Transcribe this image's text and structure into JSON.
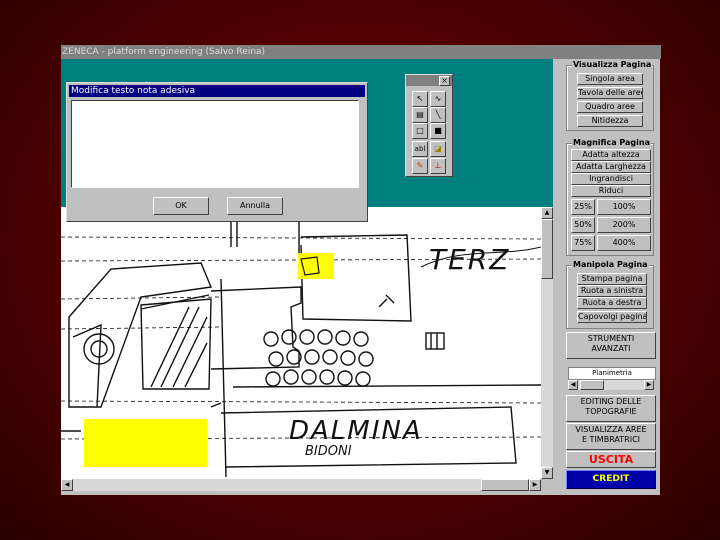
{
  "window": {
    "title": "ZENECA - platform engineering (Salvo Reina)"
  },
  "dialog": {
    "title": "Modifica testo nota adesiva",
    "text_value": "",
    "ok_label": "OK",
    "cancel_label": "Annulla"
  },
  "toolbox": {
    "close_glyph": "×",
    "tools": [
      {
        "name": "pointer",
        "glyph": "↖"
      },
      {
        "name": "freehand",
        "glyph": "∿"
      },
      {
        "name": "highlighter",
        "glyph": "▤"
      },
      {
        "name": "line",
        "glyph": "╲"
      },
      {
        "name": "hollow-rectangle",
        "glyph": "□"
      },
      {
        "name": "filled-rectangle",
        "glyph": "■"
      },
      {
        "name": "text",
        "glyph": "abl"
      },
      {
        "name": "sticky-note",
        "glyph": "◪"
      },
      {
        "name": "image-stamp",
        "glyph": "✎"
      },
      {
        "name": "rubber-stamp",
        "glyph": "⊥"
      }
    ]
  },
  "drawing": {
    "label_tert": "TERZ",
    "label_dalmina": "DALMINA",
    "label_bidoni": "BIDONI"
  },
  "sidebar": {
    "visualizza": {
      "title": "Visualizza Pagina",
      "buttons": [
        "Singola area",
        "Tavola delle aree",
        "Quadro aree",
        "Nitidezza"
      ]
    },
    "magnifica": {
      "title": "Magnifica Pagina",
      "buttons": [
        "Adatta altezza",
        "Adatta Larghezza",
        "Ingrandisci",
        "Riduci"
      ],
      "zoom": [
        "25%",
        "100%",
        "50%",
        "200%",
        "75%",
        "400%"
      ]
    },
    "manipola": {
      "title": "Manipola Pagina",
      "buttons": [
        "Stampa pagina",
        "Ruota a sinistra",
        "Ruota a destra",
        "Capovolgi pagina"
      ]
    },
    "strumenti_line1": "STRUMENTI",
    "strumenti_line2": "AVANZATI",
    "planimetria_label": "Planimetria",
    "editing_line1": "EDITING DELLE",
    "editing_line2": "TOPOGRAFIE",
    "visualizza_aree_line1": "VISUALIZZA AREE",
    "visualizza_aree_line2": "E TIMBRATRICI",
    "uscita": "USCITA",
    "credit": "CREDIT"
  },
  "colors": {
    "teal": "#007f7f",
    "highlight_yellow": "#ffff00",
    "uscita_red": "#ff0000",
    "credit_blue": "#0000a8",
    "credit_yellow": "#ffff00"
  }
}
